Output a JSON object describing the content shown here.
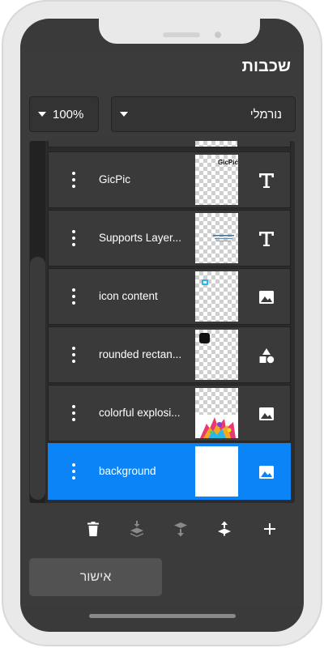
{
  "header": {
    "title": "שכבות"
  },
  "controls": {
    "opacity_value": "100%",
    "blend_mode": "נורמלי"
  },
  "layers": [
    {
      "name": "GicPic",
      "type_icon": "text-icon",
      "thumb_text": "GicPic",
      "selected": false
    },
    {
      "name": "Supports Layer...",
      "type_icon": "text-icon",
      "selected": false
    },
    {
      "name": "icon content",
      "type_icon": "image-icon",
      "selected": false
    },
    {
      "name": "rounded rectan...",
      "type_icon": "shapes-icon",
      "selected": false
    },
    {
      "name": "colorful explosi...",
      "type_icon": "image-icon",
      "selected": false
    },
    {
      "name": "background",
      "type_icon": "image-icon",
      "selected": true
    }
  ],
  "toolbar": {
    "icons": [
      "trash-icon",
      "merge-down-icon",
      "move-down-icon",
      "move-up-icon",
      "add-icon"
    ]
  },
  "footer": {
    "confirm_label": "אישור"
  },
  "colors": {
    "screen_bg": "#3a3a3a",
    "selected_row": "#0b84f8",
    "confirm_button": "#525252"
  }
}
